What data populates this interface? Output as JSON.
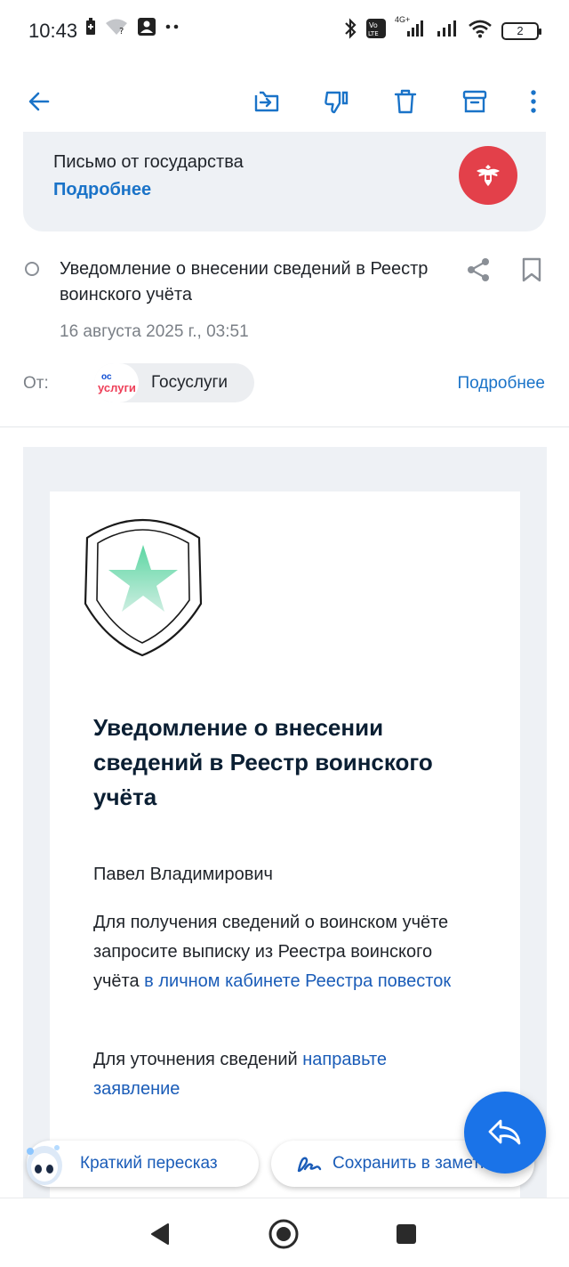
{
  "status_bar": {
    "time": "10:43",
    "battery": "2",
    "network": "4G+",
    "icons": [
      "battery-saver-icon",
      "wifi-question-icon",
      "contact-card-icon",
      "more-dots-icon",
      "bluetooth-icon",
      "volte-icon",
      "signal-icon",
      "signal-icon",
      "wifi-icon",
      "battery-icon"
    ]
  },
  "toolbar": {
    "icons": [
      "back-arrow-icon",
      "move-to-folder-icon",
      "spam-thumb-down-icon",
      "trash-icon",
      "archive-icon",
      "more-vert-icon"
    ]
  },
  "banner": {
    "title": "Письмо от государства",
    "link": "Подробнее",
    "emblem_color": "#e3404a"
  },
  "message": {
    "subject": "Уведомление о внесении сведений в Реестр воинского учёта",
    "date": "16 августа 2025 г., 03:51",
    "from_label": "От:",
    "sender": {
      "logo_line1": "ос",
      "logo_line2": "услуги",
      "name": "Госуслуги"
    },
    "details_link": "Подробнее"
  },
  "body": {
    "heading": "Уведомление о внесении сведений в Реестр воинского учёта",
    "greeting": "Павел Владимирович",
    "para1_text": "Для получения сведений о воинском учёте запросите выписку из Реестра воинского учёта",
    "para1_link": "в личном кабинете Реестра повесток",
    "para2_text": "Для уточнения сведений",
    "para2_link": "направьте заявление"
  },
  "actions": {
    "summary_label": "Краткий пересказ",
    "save_label": "Сохранить в заметки"
  },
  "colors": {
    "accent": "#1a73e8",
    "link": "#1a5cb8",
    "banner_bg": "#eef1f5",
    "emblem": "#e3404a"
  }
}
